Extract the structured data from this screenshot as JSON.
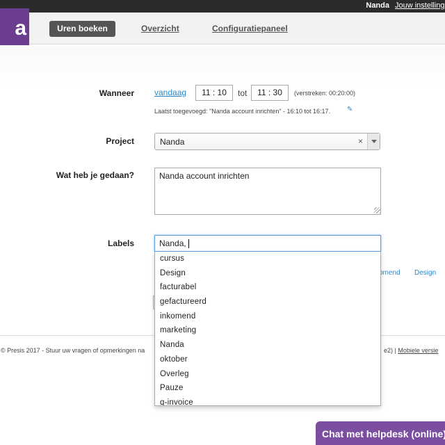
{
  "topbar": {
    "user": "Nanda",
    "settings_link": "Jouw instellingen"
  },
  "brand": {
    "logo_text": "a"
  },
  "nav": {
    "active": "Uren boeken",
    "overzicht": "Overzicht",
    "config": "Configuratiepaneel"
  },
  "form": {
    "wanneer_label": "Wanneer",
    "date_link": "vandaag",
    "time_from": "11 : 10",
    "tot": "tot",
    "time_to": "11 : 30",
    "elapsed": "(verstreken: 00:20:00)",
    "last_added": "Laatst toegevoegd: \"Nanda account inrichten\" - 16:10 tot 16:17.",
    "project_label": "Project",
    "project_value": "Nanda",
    "project_clear": "×",
    "gedaan_label": "Wat heb je gedaan?",
    "gedaan_value": "Nanda account inrichten",
    "labels_label": "Labels",
    "labels_value": "Nanda,"
  },
  "dropdown": {
    "options": [
      "cursus",
      "Design",
      "facturabel",
      "gefactureerd",
      "inkomend",
      "marketing",
      "Nanda",
      "oktober",
      "Overleg",
      "Pauze",
      "q-invoice"
    ]
  },
  "side_tags": {
    "inkomend": "komend",
    "design": "Design"
  },
  "footer": {
    "left": "© Presis 2017 - Stuur uw vragen of opmerkingen na",
    "right_suffix": "e2)  |",
    "mobile": "Mobiele versie"
  },
  "chat": {
    "label": "Chat met helpdesk (online)"
  },
  "colors": {
    "brand": "#6a3d8f",
    "link": "#2a88c8",
    "chat": "#7b4ea0"
  }
}
